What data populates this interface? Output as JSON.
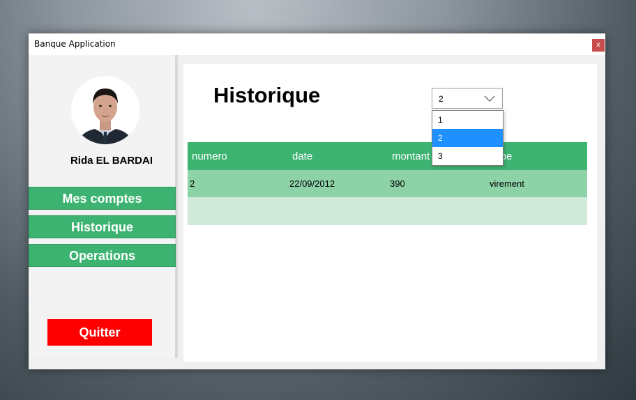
{
  "window": {
    "title": "Banque Application",
    "close_label": "x"
  },
  "sidebar": {
    "user_name": "Rida  EL BARDAI",
    "nav": [
      {
        "label": "Mes comptes"
      },
      {
        "label": "Historique"
      },
      {
        "label": "Operations"
      }
    ],
    "quit_label": "Quitter"
  },
  "main": {
    "title": "Historique",
    "account_select": {
      "value": "2",
      "options": [
        "1",
        "2",
        "3"
      ],
      "highlighted": "2"
    },
    "table": {
      "headers": [
        "numero",
        "date",
        "montant",
        "type"
      ],
      "rows": [
        [
          "2",
          "22/09/2012",
          "390",
          "virement"
        ]
      ]
    }
  },
  "colors": {
    "accent_green": "#3cb371",
    "row_green": "#8dd3a7",
    "empty_row_green": "#cfeadb",
    "quit_red": "#ff0000",
    "selection_blue": "#1e90ff"
  }
}
